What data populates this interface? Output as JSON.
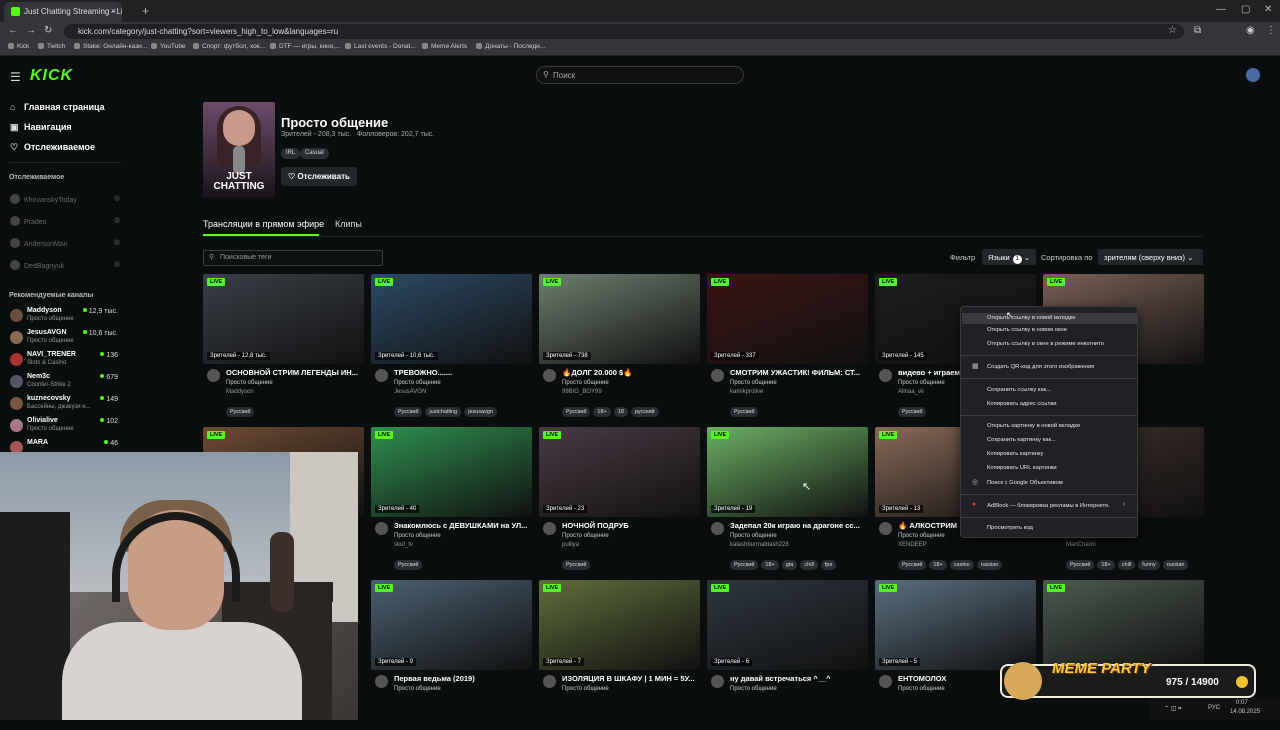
{
  "browser": {
    "tab_title": "Just Chatting Streaming - Live",
    "url": "kick.com/category/just-chatting?sort=viewers_high_to_low&languages=ru",
    "bookmarks": [
      "Kick",
      "Twitch",
      "Stake: Онлайн-кази...",
      "YouTube",
      "Спорт: футбол, хок...",
      "DTF — игры, кино,...",
      "Last events - Donat...",
      "Meme Alerts",
      "Донаты - Последн..."
    ]
  },
  "header": {
    "logo": "KICK",
    "search_placeholder": "Поиск"
  },
  "sidebar": {
    "nav": [
      {
        "icon": "⌂",
        "label": "Главная страница"
      },
      {
        "icon": "▣",
        "label": "Навигация"
      },
      {
        "icon": "♡",
        "label": "Отслеживаемое"
      }
    ],
    "following_title": "Отслеживаемое",
    "following": [
      "KhovanskyToday",
      "Pradeo",
      "AndersonMan",
      "DedBagnyuk"
    ],
    "recommended_title": "Рекомендуемые каналы",
    "recommended": [
      {
        "name": "Maddyson",
        "category": "Просто общение",
        "viewers": "12,9 тыс."
      },
      {
        "name": "JesusAVGN",
        "category": "Просто общение",
        "viewers": "10,6 тыс."
      },
      {
        "name": "NAVI_TRENER",
        "category": "Slots & Casino",
        "viewers": "136"
      },
      {
        "name": "Nem3c",
        "category": "Counter-Strike 2",
        "viewers": "679"
      },
      {
        "name": "kuznecovsky",
        "category": "Бассейны, джакузи и...",
        "viewers": "149"
      },
      {
        "name": "Olivialive",
        "category": "Просто общение",
        "viewers": "102"
      },
      {
        "name": "MARA",
        "category": "",
        "viewers": "46"
      }
    ]
  },
  "category": {
    "title": "Просто общение",
    "stats": "Зрителей - 208,3 тыс.   Фолловеров: 202,7 тыс.",
    "tags": [
      "IRL",
      "Casual"
    ],
    "follow_label": "Отслеживать",
    "image_text": "JUST CHATTING"
  },
  "tabs": {
    "live": "Трансляции в прямом эфире",
    "clips": "Клипы"
  },
  "filters": {
    "tag_search_placeholder": "Поисковые теги",
    "filter_label": "Фильтр",
    "languages_label": "Языки",
    "languages_count": "1",
    "sort_label": "Сортировка по",
    "sort_value": "зрителям (сверху вниз)"
  },
  "live_badge": "LIVE",
  "cards": [
    {
      "viewers": "Зрителей - 12,8 тыс.",
      "title": "ОСНОВНОЙ СТРИМ ЛЕГЕНДЫ ИН...",
      "category": "Просто общение",
      "user": "Maddyson",
      "tags": [
        "Русский"
      ],
      "color": "#3a3f47"
    },
    {
      "viewers": "Зрителей - 10,6 тыс.",
      "title": "ТРЕВОЖНО.......",
      "category": "Просто общение",
      "user": "JesusAVGN",
      "tags": [
        "Русский",
        "justchatting",
        "jesusavgn"
      ],
      "color": "#2c4a66"
    },
    {
      "viewers": "Зрителей - 738",
      "title": "🔥ДОЛГ 20.000 $🔥",
      "category": "Просто общение",
      "user": "99BIG_BOY99",
      "tags": [
        "Русский",
        "18+",
        "18",
        "русский"
      ],
      "color": "#6d7f6e"
    },
    {
      "viewers": "Зрителей - 337",
      "title": "СМОТРИМ УЖАСТИК! ФИЛЬМ: СТ...",
      "category": "Просто общение",
      "user": "kamikprolive",
      "tags": [
        "Русский"
      ],
      "color": "#3b1412"
    },
    {
      "viewers": "Зрителей - 145",
      "title": "видево + играем!!",
      "category": "Просто общение",
      "user": "Alinaa_vii",
      "tags": [
        "Русский"
      ],
      "color": "#1d1b1c"
    },
    {
      "viewers": "",
      "title": "",
      "category": "",
      "user": "",
      "tags": [],
      "color": "#7a5f55"
    },
    {
      "viewers": "",
      "title": "",
      "category": "",
      "user": "",
      "tags": [],
      "color": "#6e4a32"
    },
    {
      "viewers": "Зрителей - 40",
      "title": "Знакомлюсь с ДЕВУШКАМИ на УЛ...",
      "category": "Просто общение",
      "user": "skuf_tv",
      "tags": [
        "Русский"
      ],
      "color": "#2e8f4e"
    },
    {
      "viewers": "Зрителей - 23",
      "title": "НОЧНОЙ ПОДРУБ",
      "category": "Просто общение",
      "user": "pulliya",
      "tags": [
        "Русский"
      ],
      "color": "#4a3a44"
    },
    {
      "viewers": "Зрителей - 19",
      "title": "Задепал 20к играю на драгоне сс...",
      "category": "Просто общение",
      "user": "kalashburmaldash228",
      "tags": [
        "Русский",
        "18+",
        "gta",
        "chill",
        "fps"
      ],
      "color": "#6bb063"
    },
    {
      "viewers": "Зрителей - 13",
      "title": "🔥 АЛКОСТРИМ",
      "category": "Просто общение",
      "user": "XENDEEP",
      "tags": [
        "Русский",
        "18+",
        "casino",
        "russian"
      ],
      "color": "#8a6a58"
    },
    {
      "viewers": "",
      "title": "",
      "category": "",
      "user": "MariCharm",
      "tags": [
        "Русский",
        "18+",
        "chill",
        "funny",
        "russian"
      ],
      "color": "#3e2e2a"
    },
    {
      "viewers": "Зрителей - 9",
      "title": "Первая ведьма (2019)",
      "category": "Просто общение",
      "user": "",
      "tags": [],
      "color": "#4b6072"
    },
    {
      "viewers": "Зрителей - 7",
      "title": "ИЗОЛЯЦИЯ В ШКАФУ | 1 МИН = 5У...",
      "category": "Просто общение",
      "user": "",
      "tags": [],
      "color": "#5f6e3a"
    },
    {
      "viewers": "Зрителей - 6",
      "title": "ну давай встречаться ^__^",
      "category": "Просто общение",
      "user": "",
      "tags": [],
      "color": "#2d3640"
    },
    {
      "viewers": "Зрителей - 5",
      "title": "ЕНТОМОЛОХ",
      "category": "Просто общение",
      "user": "",
      "tags": [],
      "color": "#5a6f80"
    },
    {
      "viewers": "",
      "title": "",
      "category": "",
      "user": "",
      "tags": [],
      "color": "#4b5a4f"
    }
  ],
  "context_menu": [
    "Открыть ссылку в новой вкладке",
    "Открыть ссылку в новом окне",
    "Открыть ссылку в окне в режиме инкогнито",
    "Создать QR-код для этого изображения",
    "Сохранить ссылку как...",
    "Копировать адрес ссылки",
    "Открыть картинку в новой вкладке",
    "Сохранить картинку как...",
    "Копировать картинку",
    "Копировать URL картинки",
    "Поиск с Google Объективом",
    "AdBlock — блокировка рекламы в Интернете.",
    "Просмотреть код"
  ],
  "overlay": {
    "meme_title": "MEME PARTY",
    "meme_count": "975 / 14900"
  },
  "tray": {
    "lang": "РУС",
    "time": "0:07",
    "date": "14.08.2025"
  }
}
